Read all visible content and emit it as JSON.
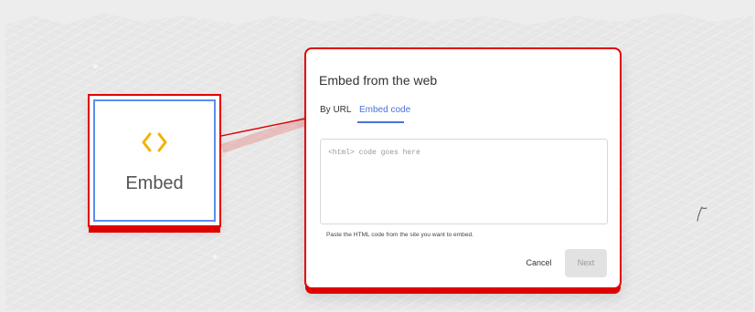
{
  "thumbnail": {
    "label": "Embed",
    "icon": "code-brackets-icon",
    "highlight_color": "#e00000",
    "selection_color": "#5b8ef0",
    "icon_color": "#f2b300"
  },
  "dialog": {
    "title": "Embed from the web",
    "tabs": [
      {
        "label": "By URL",
        "selected": false
      },
      {
        "label": "Embed code",
        "selected": true
      }
    ],
    "code_input": {
      "placeholder": "<html> code goes here",
      "value": ""
    },
    "helper_text": "Paste the HTML code from the site you want to embed.",
    "buttons": {
      "cancel": "Cancel",
      "next": "Next"
    },
    "accent_color": "#4a73d8"
  }
}
